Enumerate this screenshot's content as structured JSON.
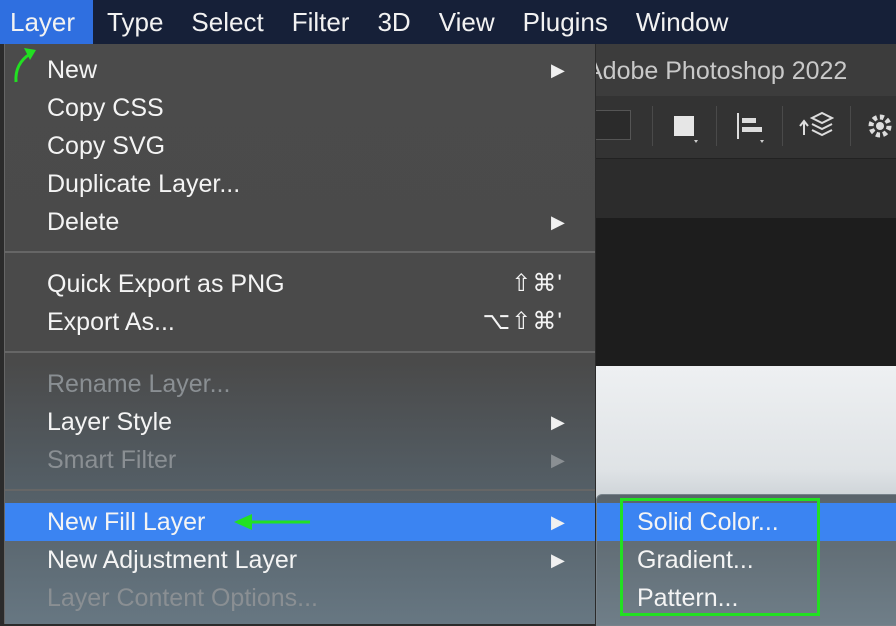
{
  "menubar": {
    "items": [
      "Layer",
      "Type",
      "Select",
      "Filter",
      "3D",
      "View",
      "Plugins",
      "Window"
    ]
  },
  "window": {
    "title": "Adobe Photoshop 2022"
  },
  "menu": {
    "groups": [
      [
        {
          "label": "New",
          "submenu": true
        },
        {
          "label": "Copy CSS"
        },
        {
          "label": "Copy SVG"
        },
        {
          "label": "Duplicate Layer..."
        },
        {
          "label": "Delete",
          "submenu": true
        }
      ],
      [
        {
          "label": "Quick Export as PNG",
          "shortcut": "⇧⌘'"
        },
        {
          "label": "Export As...",
          "shortcut": "⌥⇧⌘'"
        }
      ],
      [
        {
          "label": "Rename Layer...",
          "disabled": true
        },
        {
          "label": "Layer Style",
          "submenu": true
        },
        {
          "label": "Smart Filter",
          "submenu": true,
          "disabled": true
        }
      ],
      [
        {
          "label": "New Fill Layer",
          "submenu": true,
          "highlighted": true
        },
        {
          "label": "New Adjustment Layer",
          "submenu": true
        },
        {
          "label": "Layer Content Options...",
          "disabled": true
        }
      ]
    ],
    "submenu_arrow": "▶"
  },
  "submenu": {
    "items": [
      "Solid Color...",
      "Gradient...",
      "Pattern..."
    ]
  },
  "colors": {
    "menubar": "#162038",
    "highlight": "#3b84f2",
    "annotation": "#22e022"
  }
}
